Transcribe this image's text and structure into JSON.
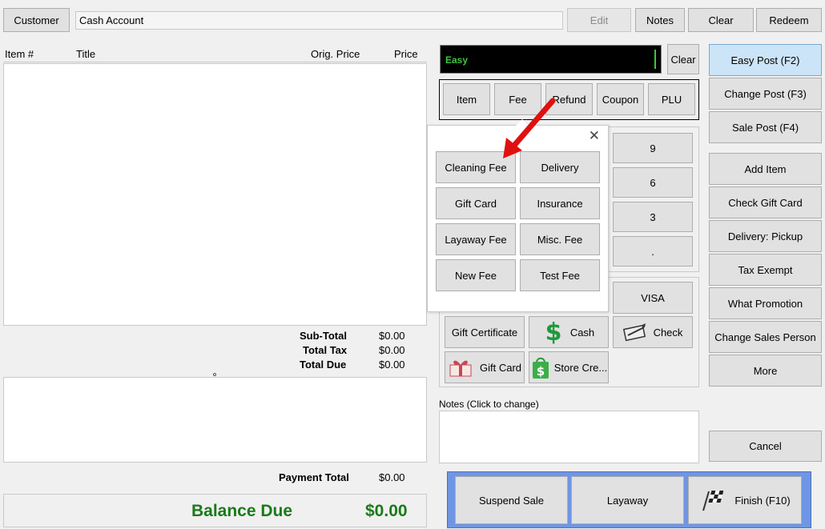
{
  "top": {
    "customer_label": "Customer",
    "customer_value": "Cash Account",
    "edit_label": "Edit",
    "notes_label": "Notes",
    "clear_label": "Clear",
    "redeem_label": "Redeem"
  },
  "table": {
    "columns": [
      "Item #",
      "Title",
      "Orig. Price",
      "Price"
    ]
  },
  "totals": {
    "subtotal_label": "Sub-Total",
    "subtotal_value": "$0.00",
    "tax_label": "Total Tax",
    "tax_value": "$0.00",
    "due_label": "Total Due",
    "due_value": "$0.00",
    "payment_label": "Payment Total",
    "payment_value": "$0.00",
    "balance_label": "Balance Due",
    "balance_value": "$0.00"
  },
  "entry": {
    "mode_value": "Easy",
    "clear_label": "Clear",
    "tabs": [
      "Item",
      "Fee",
      "Refund",
      "Coupon",
      "PLU"
    ]
  },
  "fee_popup": {
    "close_icon": "✕",
    "items": [
      "Cleaning Fee",
      "Delivery",
      "Gift Card",
      "Insurance",
      "Layaway Fee",
      "Misc. Fee",
      "New Fee",
      "Test Fee"
    ]
  },
  "keypad": {
    "keys": [
      "9",
      "6",
      "3",
      "."
    ]
  },
  "payments": {
    "visa": "VISA",
    "gift_certificate": "Gift Certificate",
    "cash": "Cash",
    "check": "Check",
    "gift_card": "Gift Card",
    "store_credit": "Store Cre..."
  },
  "notes": {
    "label": "Notes (Click to change)"
  },
  "right": {
    "buttons": [
      "Easy Post (F2)",
      "Change Post (F3)",
      "Sale Post (F4)",
      "Add Item",
      "Check Gift Card",
      "Delivery: Pickup",
      "Tax Exempt",
      "What Promotion",
      "Change Sales Person",
      "More"
    ],
    "cancel_label": "Cancel"
  },
  "bottom": {
    "suspend_label": "Suspend Sale",
    "layaway_label": "Layaway",
    "finish_label": "Finish (F10)"
  },
  "colors": {
    "balance_green": "#1a7a1a",
    "easy_green": "#3cc73c",
    "arrow_red": "#e01010",
    "bottom_bar_blue": "#6f96e4"
  }
}
